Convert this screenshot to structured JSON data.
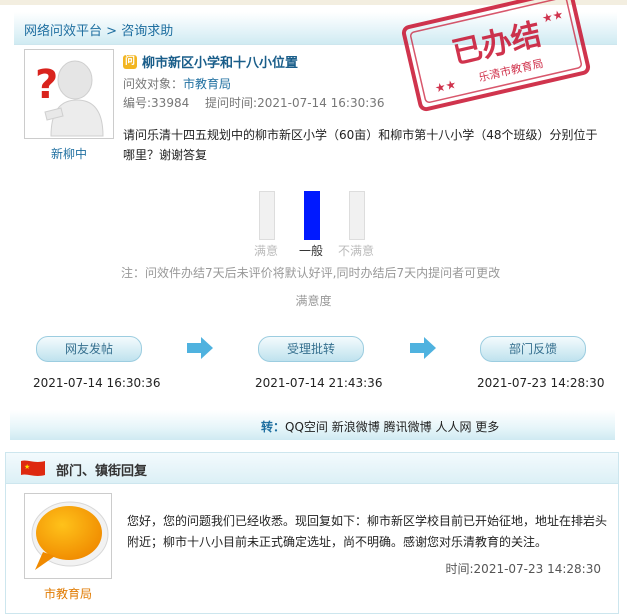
{
  "breadcrumb": {
    "platform": "网络问效平台",
    "sep": " > ",
    "section": "咨询求助"
  },
  "stamp": {
    "main": "已办结",
    "sub": "乐清市教育局",
    "color": "#c8102e"
  },
  "asker": {
    "name": "新柳中"
  },
  "question": {
    "title": "柳市新区小学和十八小位置",
    "target_label": "问效对象：",
    "target": "市教育局",
    "number_label": "编号:33984",
    "time_label": "提问时间:2021-07-14 16:30:36",
    "body": "请问乐清十四五规划中的柳市新区小学（60亩）和柳市第十八小学（48个班级）分别位于哪里？谢谢答复"
  },
  "satisfaction": {
    "options": [
      "满意",
      "一般",
      "不满意"
    ],
    "selected": 1,
    "note": "注：问效件办结7天后未评价将默认好评,同时办结后7天内提问者可更改",
    "label": "满意度"
  },
  "steps": [
    {
      "label": "网友发帖",
      "time": "2021-07-14 16:30:36"
    },
    {
      "label": "受理批转",
      "time": "2021-07-14 21:43:36"
    },
    {
      "label": "部门反馈",
      "time": "2021-07-23 14:28:30"
    }
  ],
  "share": {
    "prefix": "转：",
    "links": [
      "QQ空间",
      "新浪微博",
      "腾讯微博",
      "人人网",
      "更多"
    ]
  },
  "reply": {
    "heading": "部门、镇街回复",
    "department": "市教育局",
    "body": "您好，您的问题我们已经收悉。现回复如下：柳市新区学校目前已开始征地，地址在排岩头附近；柳市十八小目前未正式确定选址，尚不明确。感谢您对乐清教育的关注。",
    "time": "时间:2021-07-23 14:28:30"
  }
}
